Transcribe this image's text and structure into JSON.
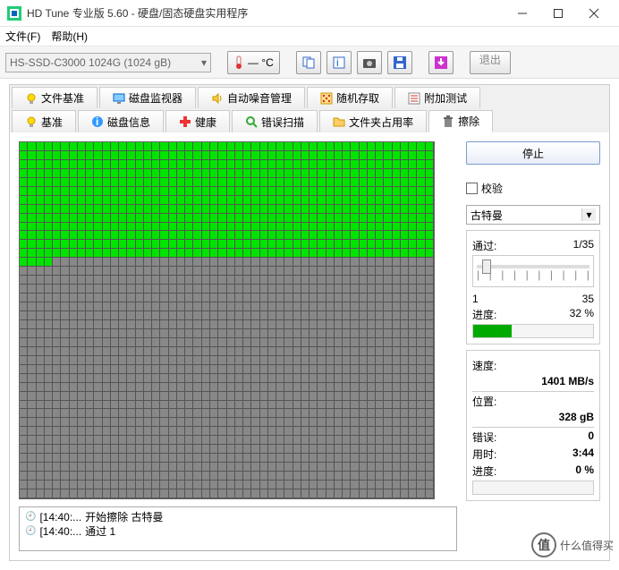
{
  "window": {
    "title": "HD Tune 专业版 5.60 - 硬盘/固态硬盘实用程序"
  },
  "menus": {
    "file": "文件(F)",
    "help": "帮助(H)"
  },
  "toolbar": {
    "drive": "HS-SSD-C3000 1024G (1024 gB)",
    "temp": "— °C",
    "exit": "退出"
  },
  "tabs": {
    "row1": {
      "file_benchmark": "文件基准",
      "disk_monitor": "磁盘监视器",
      "auto_noise": "自动噪音管理",
      "random_access": "随机存取",
      "extra_tests": "附加测试"
    },
    "row2": {
      "benchmark": "基准",
      "disk_info": "磁盘信息",
      "health": "健康",
      "error_scan": "错误扫描",
      "folder_usage": "文件夹占用率",
      "erase": "擦除"
    }
  },
  "side": {
    "stop": "停止",
    "verify": "校验",
    "method": "古特曼",
    "pass_label": "通过:",
    "pass_value": "1/35",
    "range_lo": "1",
    "range_hi": "35",
    "progress_label": "进度:",
    "progress_value": "32 %",
    "progress_pct": 32,
    "speed_label": "速度:",
    "speed_value": "1401 MB/s",
    "position_label": "位置:",
    "position_value": "328 gB",
    "errors_label": "错误:",
    "errors_value": "0",
    "time_label": "用时:",
    "time_value": "3:44",
    "prog2_label": "进度:",
    "prog2_value": "0 %"
  },
  "log": {
    "line1_time": "[14:40:...",
    "line1_text": "开始擦除 古特曼",
    "line2_time": "[14:40:...",
    "line2_text": "通过 1"
  },
  "grid": {
    "cols": 50,
    "rows": 40,
    "done_rows": 13,
    "partial_row_done": 4
  },
  "watermark": {
    "logo": "值",
    "text": "什么值得买"
  }
}
